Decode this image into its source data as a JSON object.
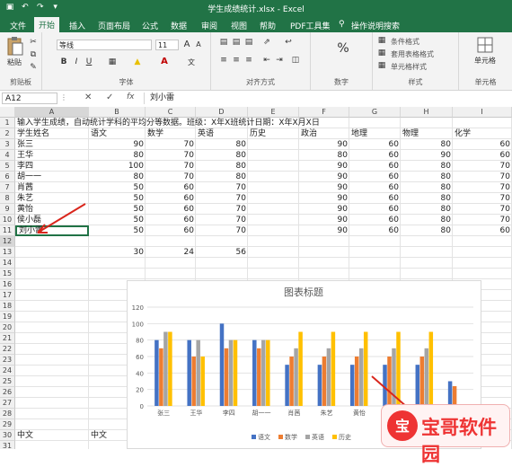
{
  "window": {
    "title": "学生成绩统计.xlsx - Excel"
  },
  "tabs": [
    "文件",
    "开始",
    "插入",
    "页面布局",
    "公式",
    "数据",
    "审阅",
    "视图",
    "帮助",
    "PDF工具集",
    "操作说明搜索"
  ],
  "active_tab": "开始",
  "ribbon": {
    "paste_label": "粘贴",
    "clipboard_label": "剪贴板",
    "font_group_label": "字体",
    "font_name": "等线",
    "font_size": "11",
    "align_group_label": "对齐方式",
    "number_group_label": "数字",
    "number_symbol": "%",
    "styles_group_label": "样式",
    "cond_format": "条件格式",
    "table_format": "套用表格格式",
    "cell_style": "单元格样式",
    "cells_group_label": "单元格",
    "cells_btn": "单元格",
    "bold": "B",
    "italic": "I",
    "underline": "U"
  },
  "formula_bar": {
    "name_box": "A12",
    "cancel": "✕",
    "confirm": "✓",
    "fx": "fx",
    "content": "刘小雷"
  },
  "columns": [
    "A",
    "B",
    "C",
    "D",
    "E",
    "F",
    "G",
    "H",
    "I"
  ],
  "rows": [
    "1",
    "2",
    "3",
    "4",
    "5",
    "6",
    "7",
    "8",
    "9",
    "10",
    "11",
    "12",
    "13",
    "14",
    "15",
    "16",
    "17",
    "18",
    "19",
    "20",
    "21",
    "22",
    "23",
    "24",
    "25",
    "26",
    "27",
    "28",
    "29",
    "30",
    "31"
  ],
  "sheet": {
    "note": "输入学生成绩，自动统计学科的平均分等数据。班级：X年X班统计日期：X年X月X日",
    "headers": [
      "学生姓名",
      "语文",
      "数学",
      "英语",
      "历史",
      "政治",
      "地理",
      "物理",
      "化学"
    ],
    "students": [
      {
        "name": "张三",
        "scores": [
          "90",
          "70",
          "80",
          "",
          "90",
          "60",
          "80",
          "60"
        ]
      },
      {
        "name": "王华",
        "scores": [
          "80",
          "70",
          "80",
          "",
          "80",
          "60",
          "90",
          "60"
        ]
      },
      {
        "name": "李四",
        "scores": [
          "100",
          "70",
          "80",
          "",
          "90",
          "60",
          "80",
          "70"
        ]
      },
      {
        "name": "胡一一",
        "scores": [
          "80",
          "70",
          "80",
          "",
          "90",
          "60",
          "80",
          "70"
        ]
      },
      {
        "name": "肖茜",
        "scores": [
          "50",
          "60",
          "70",
          "",
          "90",
          "60",
          "80",
          "70"
        ]
      },
      {
        "name": "朱艺",
        "scores": [
          "50",
          "60",
          "70",
          "",
          "90",
          "60",
          "80",
          "70"
        ]
      },
      {
        "name": "黄怡",
        "scores": [
          "50",
          "60",
          "70",
          "",
          "90",
          "60",
          "80",
          "70"
        ]
      },
      {
        "name": "侯小磊",
        "scores": [
          "50",
          "60",
          "70",
          "",
          "90",
          "60",
          "80",
          "70"
        ]
      },
      {
        "name": "刘小雷",
        "scores": [
          "50",
          "60",
          "70",
          "",
          "90",
          "60",
          "80",
          "60"
        ]
      }
    ],
    "row13": [
      "30",
      "24",
      "56"
    ],
    "row30": [
      "中文",
      "中文"
    ]
  },
  "chart_data": {
    "type": "bar",
    "title": "图表标题",
    "categories": [
      "张三",
      "王华",
      "李四",
      "胡一一",
      "肖茜",
      "朱艺",
      "黄怡",
      "侯小磊",
      "刘小雷",
      ""
    ],
    "series": [
      {
        "name": "语文",
        "color": "#4472C4",
        "values": [
          80,
          80,
          100,
          80,
          50,
          50,
          50,
          50,
          50,
          30
        ]
      },
      {
        "name": "数学",
        "color": "#ED7D31",
        "values": [
          70,
          60,
          70,
          70,
          60,
          60,
          60,
          60,
          60,
          24
        ]
      },
      {
        "name": "英语",
        "color": "#A5A5A5",
        "values": [
          90,
          80,
          80,
          80,
          70,
          70,
          70,
          70,
          70,
          0
        ]
      },
      {
        "name": "历史",
        "color": "#FFC000",
        "values": [
          90,
          60,
          80,
          80,
          90,
          90,
          90,
          90,
          90,
          0
        ]
      }
    ],
    "ylim": [
      0,
      120
    ],
    "yticks": [
      "0",
      "20",
      "40",
      "60",
      "80",
      "100",
      "120"
    ],
    "legend": "bottom"
  },
  "watermark": "宝哥软件园",
  "colors": {
    "excel_green": "#217346",
    "arrow": "#d9261c"
  }
}
